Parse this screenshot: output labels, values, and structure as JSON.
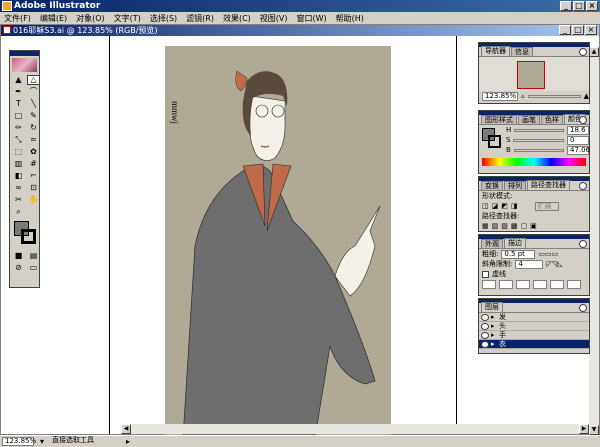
{
  "app": {
    "title": "Adobe Illustrator",
    "window_buttons": [
      "_",
      "□",
      "×"
    ]
  },
  "menu": [
    "文件(F)",
    "编辑(E)",
    "对象(O)",
    "文字(T)",
    "选择(S)",
    "滤镜(R)",
    "效果(C)",
    "视图(V)",
    "窗口(W)",
    "帮助(H)"
  ],
  "document": {
    "title": "016耶稣S3.ai @ 123.85% (RGB/预览)",
    "window_buttons": [
      "_",
      "□",
      "×"
    ]
  },
  "artwork": {
    "signature": "mmwj",
    "colors": {
      "background": "#b0a996",
      "robe": "#6e6e6e",
      "undershirt": "#c06a4a",
      "skin": "#f4f1e8",
      "hair": "#5a4a3e"
    }
  },
  "navigator": {
    "tabs": [
      "导航器",
      "信息"
    ],
    "zoom": "123.85%"
  },
  "color_panel": {
    "tabs": [
      "图形样式",
      "画笔",
      "色样",
      "颜色"
    ],
    "channels": [
      {
        "name": "H",
        "value": "18.6"
      },
      {
        "name": "S",
        "value": "0"
      },
      {
        "name": "B",
        "value": "47.06"
      }
    ]
  },
  "pathfinder": {
    "tabs": [
      "变换",
      "排列",
      "路径查找器"
    ],
    "shape_mode_label": "形状模式:",
    "pathfinder_label": "路径查找器:",
    "expand_label": "扩展"
  },
  "stroke": {
    "tabs": [
      "外观",
      "描边"
    ],
    "weight_label": "粗细:",
    "weight_value": "0.5 pt",
    "miter_label": "斜角限制:",
    "miter_value": "4",
    "dashed_label": "虚线"
  },
  "layers": {
    "tab": "图层",
    "items": [
      {
        "name": "发",
        "selected": false
      },
      {
        "name": "头",
        "selected": false
      },
      {
        "name": "手",
        "selected": false
      },
      {
        "name": "衣",
        "selected": true
      }
    ],
    "count_label": "1 图层"
  },
  "status": {
    "zoom": "123.85%",
    "tool": "直接选取工具"
  }
}
